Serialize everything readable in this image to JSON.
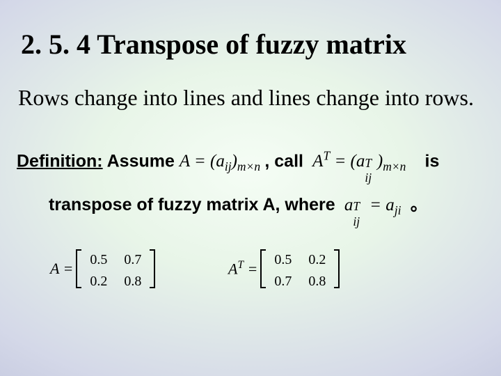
{
  "heading": "2. 5. 4 Transpose of fuzzy matrix",
  "intro": "Rows change into lines and lines change into rows.",
  "def": {
    "label": "Definition:",
    "assume": "Assume",
    "f_aij": "A = (a",
    "f_aij_sub": "ij",
    "f_aij_close": ")",
    "f_aij_dim": "m×n",
    "comma_call": ", call",
    "f_at": "A",
    "f_at_sup": "T",
    "f_at_mid": " = (a",
    "f_at_subsup_sub": "ij",
    "f_at_subsup_sup": "T",
    "f_at_close": ")",
    "f_at_dim": "m×n",
    "is": "is",
    "line2_text": "transpose of fuzzy matrix  A, where",
    "f_elem_a": "a",
    "f_elem_ij": "ij",
    "f_elem_T": "T",
    "f_elem_eq": " = a",
    "f_elem_ji": "ji",
    "period": "。"
  },
  "example": {
    "A_label": "A =",
    "AT_label": "A",
    "AT_sup": "T",
    "AT_eq": " =",
    "A": [
      [
        "0.5",
        "0.7"
      ],
      [
        "0.2",
        "0.8"
      ]
    ],
    "AT": [
      [
        "0.5",
        "0.2"
      ],
      [
        "0.7",
        "0.8"
      ]
    ]
  }
}
